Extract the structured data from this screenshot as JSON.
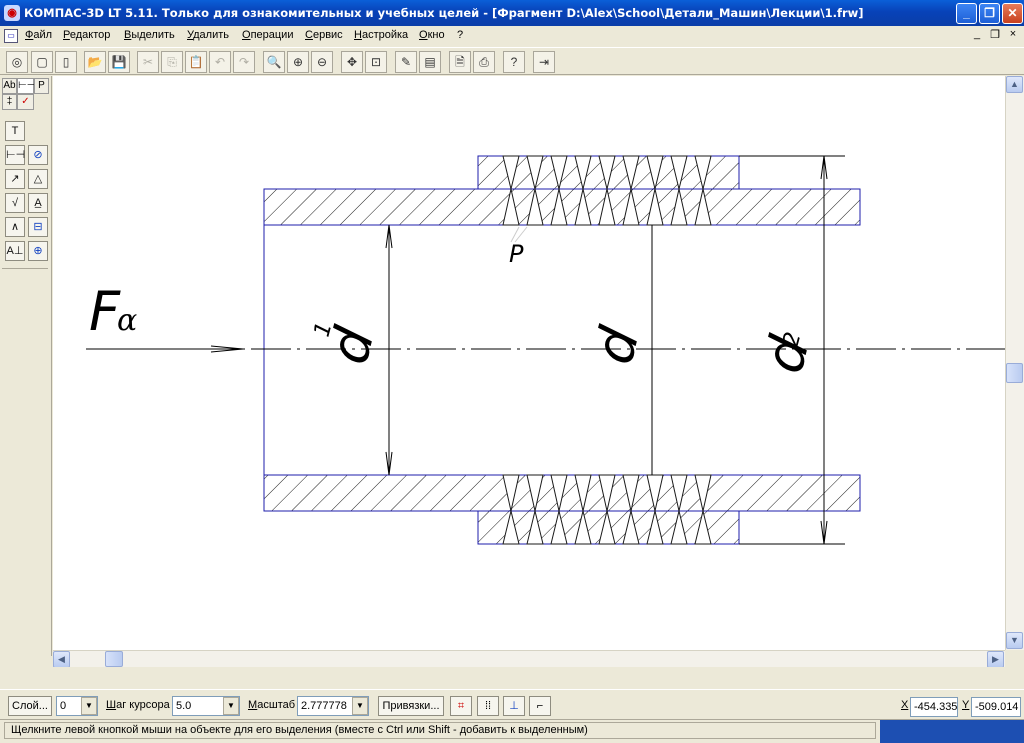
{
  "window": {
    "title": "КОМПАС-3D LT 5.11. Только для ознакомительных и учебных целей - [Фрагмент D:\\Alex\\School\\Детали_Машин\\Лекции\\1.frw]",
    "minimize": "_",
    "maximize": "❐",
    "close": "✕"
  },
  "menu": {
    "items": [
      "Файл",
      "Редактор",
      "Выделить",
      "Удалить",
      "Операции",
      "Сервис",
      "Настройка",
      "Окно",
      "?"
    ],
    "mdi_minimize": "_",
    "mdi_restore": "❐",
    "mdi_close": "×"
  },
  "toolbar": {
    "icons": [
      "rebuild-icon",
      "new-file-icon",
      "new-doc-icon",
      "open-folder-icon",
      "save-icon",
      "cut-icon",
      "copy-icon",
      "paste-icon",
      "undo-icon",
      "redo-icon",
      "zoom-window-icon",
      "zoom-in-icon",
      "zoom-out-icon",
      "pan-icon",
      "zoom-fit-icon",
      "redraw-icon",
      "layer-icon",
      "print-preview-icon",
      "print-icon",
      "help-icon",
      "exit-icon"
    ],
    "glyphs": [
      "◎",
      "▢",
      "▯",
      "📂",
      "💾",
      "✂",
      "⎘",
      "📋",
      "↶",
      "↷",
      "🔍",
      "⊕",
      "⊖",
      "✥",
      "⊡",
      "✎",
      "▤",
      "🗎",
      "⎙",
      "?",
      "⇥"
    ]
  },
  "left_panel": {
    "tabs": [
      "Ab",
      "⊢⊣",
      "P",
      "‡",
      "✓"
    ],
    "tools": [
      "T",
      "⊢⊣",
      "⊘",
      "↗",
      "△",
      "√",
      "A̲",
      "∧",
      "⊟",
      "A⊥",
      "⊕"
    ]
  },
  "drawing": {
    "force_label": "F",
    "force_sub": "α",
    "pitch_label": "P",
    "d1_main": "d",
    "d1_sub": "1",
    "d_main": "d",
    "d2_main": "d",
    "d2_sub": "2",
    "colors": {
      "outline": "#1c1cab",
      "hatch": "#1a1a1a",
      "dim": "#000000"
    }
  },
  "bottom_bar": {
    "layer_button": "Слой...",
    "layer_value": "0",
    "step_label": "Шаг курсора",
    "step_value": "5.0",
    "scale_label": "Масштаб",
    "scale_value": "2.777778",
    "snaps_button": "Привязки...",
    "x_label": "X",
    "x_value": "-454.335",
    "y_label": "Y",
    "y_value": "-509.014"
  },
  "status": {
    "message": "Щелкните левой кнопкой мыши на объекте для его выделения (вместе с Ctrl или Shift - добавить к выделенным)"
  }
}
